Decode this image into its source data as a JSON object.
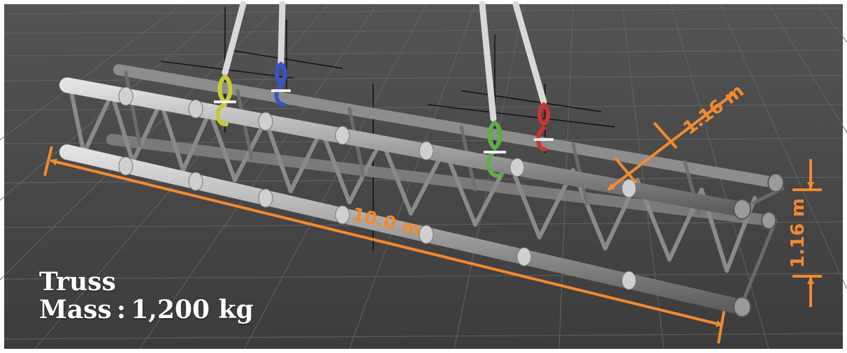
{
  "caption": {
    "title": "Truss",
    "mass": "Mass : 1,200 kg"
  },
  "dimensions": {
    "length_label": "10.0 m",
    "width_label": "1.16 m",
    "height_label": "1.16 m"
  },
  "colors": {
    "background": "#4a4a4a",
    "grid": "#5c5c5c",
    "truss_metal": "#a9a9a9",
    "truss_dark": "#6e6e6e",
    "dimension": "#f28a2e",
    "hook_yellow": "#c9c93a",
    "hook_blue": "#3556c8",
    "hook_green": "#5fae45",
    "hook_red": "#c8382e",
    "sling": "#d8d8d8"
  },
  "icons": [
    "crane-hook-icon",
    "crosshair-marker-icon",
    "dimension-arrow-icon"
  ]
}
